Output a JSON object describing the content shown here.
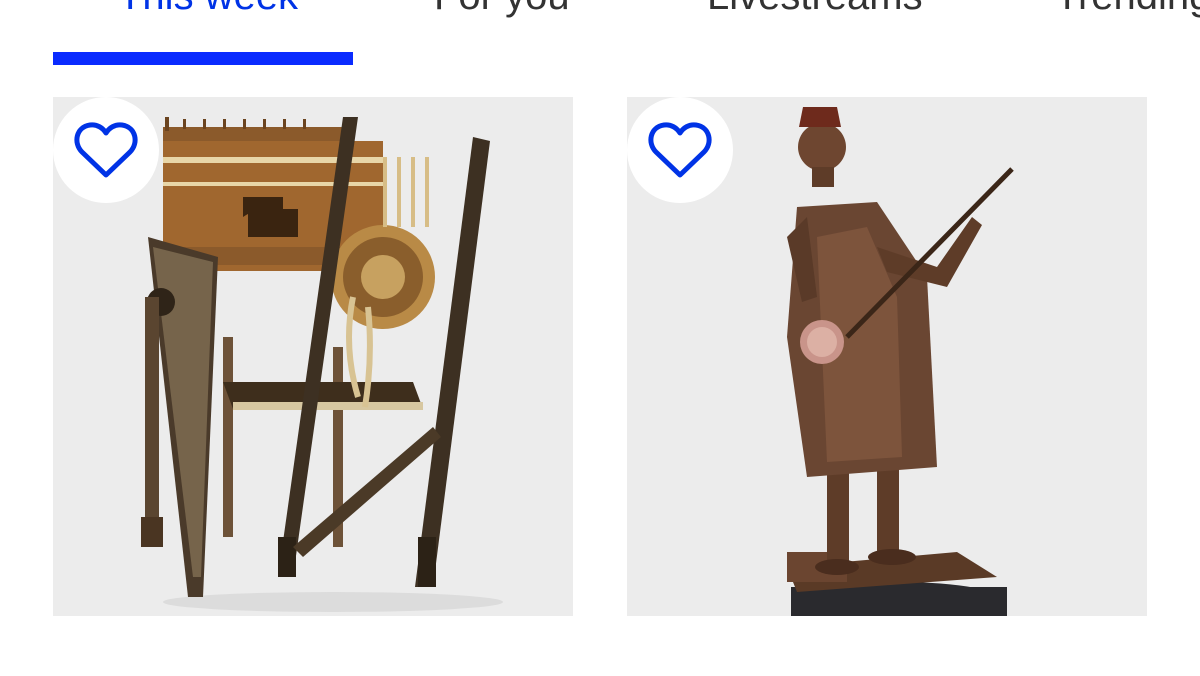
{
  "tabs": [
    {
      "label": "This week",
      "active": true
    },
    {
      "label": "For you",
      "active": false
    },
    {
      "label": "Livestreams",
      "active": false
    },
    {
      "label": "Trending",
      "active": false
    }
  ],
  "accent_color": "#0a2bff",
  "cards": [
    {
      "image": "ornate-inlaid-chair",
      "favorite_icon": "heart-outline-icon"
    },
    {
      "image": "bronze-musician-statue",
      "favorite_icon": "heart-outline-icon"
    }
  ]
}
